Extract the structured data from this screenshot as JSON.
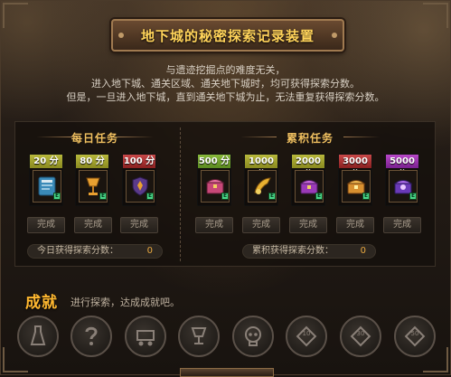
{
  "header": {
    "title": "地下城的秘密探索记录装置"
  },
  "description": {
    "lines": [
      "与遗迹挖掘点的难度无关，",
      "进入地下城、通关区域、通关地下城时，均可获得探索分数。",
      "但是，一旦进入地下城，直到通关地下城为止，无法重复获得探索分数。"
    ]
  },
  "daily": {
    "title": "每日任务",
    "tasks": [
      {
        "score": "20 分",
        "color": "#8a8a20",
        "icon": "scroll-icon",
        "button": "完成"
      },
      {
        "score": "80 分",
        "color": "#8a8a20",
        "icon": "goblet-icon",
        "button": "完成"
      },
      {
        "score": "100 分",
        "color": "#8a2020",
        "icon": "shield-icon",
        "button": "完成"
      }
    ],
    "summary_label": "今日获得探索分数：",
    "summary_value": "0"
  },
  "cumulative": {
    "title": "累积任务",
    "tasks": [
      {
        "score": "500 分",
        "color": "#5a8a20",
        "icon": "chest-icon",
        "button": "完成"
      },
      {
        "score": "1000 分",
        "color": "#8a8a20",
        "icon": "gold-horn-icon",
        "button": "完成"
      },
      {
        "score": "2000 分",
        "color": "#8a8a20",
        "icon": "treasure-chest-icon",
        "button": "完成"
      },
      {
        "score": "3000 分",
        "color": "#8a2020",
        "icon": "gold-chest-icon",
        "button": "完成"
      },
      {
        "score": "5000 分",
        "color": "#7a2090",
        "icon": "magic-chest-icon",
        "button": "完成"
      }
    ],
    "summary_label": "累积获得探索分数：",
    "summary_value": "0"
  },
  "achievements": {
    "title": "成就",
    "description": "进行探索，达成成就吧。",
    "medals": [
      {
        "icon": "potion-bottle-icon"
      },
      {
        "icon": "question-icon"
      },
      {
        "icon": "cart-icon"
      },
      {
        "icon": "chalice-icon"
      },
      {
        "icon": "skull-icon"
      },
      {
        "icon": "badge-10-icon",
        "label": "10"
      },
      {
        "icon": "badge-30-icon",
        "label": "30"
      },
      {
        "icon": "badge-50-icon",
        "label": "50"
      }
    ]
  }
}
